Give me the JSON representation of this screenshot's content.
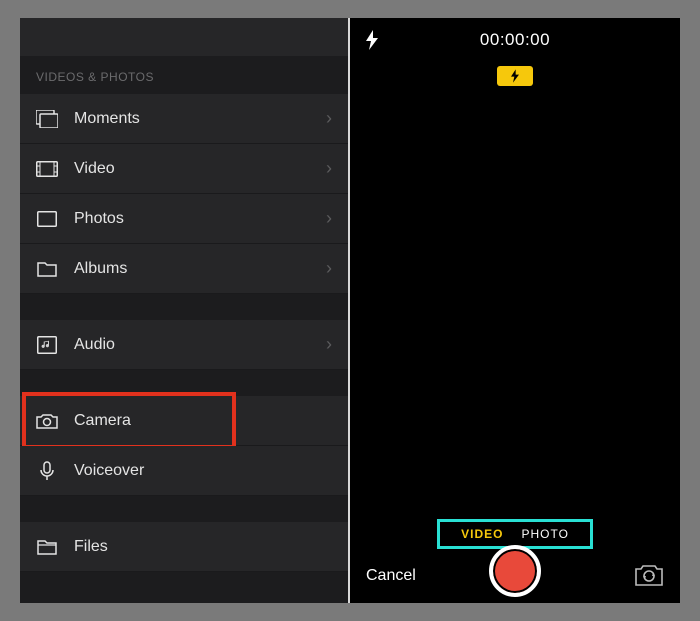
{
  "left": {
    "section_header": "VIDEOS & PHOTOS",
    "group1": [
      {
        "icon": "moments",
        "label": "Moments",
        "chevron": true
      },
      {
        "icon": "video",
        "label": "Video",
        "chevron": true
      },
      {
        "icon": "photos",
        "label": "Photos",
        "chevron": true
      },
      {
        "icon": "albums",
        "label": "Albums",
        "chevron": true
      }
    ],
    "group2": [
      {
        "icon": "audio",
        "label": "Audio",
        "chevron": true
      }
    ],
    "group3": [
      {
        "icon": "camera",
        "label": "Camera",
        "chevron": false,
        "highlight": "red"
      },
      {
        "icon": "voiceover",
        "label": "Voiceover",
        "chevron": false
      }
    ],
    "group4": [
      {
        "icon": "files",
        "label": "Files",
        "chevron": false
      }
    ]
  },
  "camera": {
    "timer": "00:00:00",
    "modes": {
      "video": "VIDEO",
      "photo": "PHOTO",
      "active": "video"
    },
    "cancel": "Cancel"
  }
}
